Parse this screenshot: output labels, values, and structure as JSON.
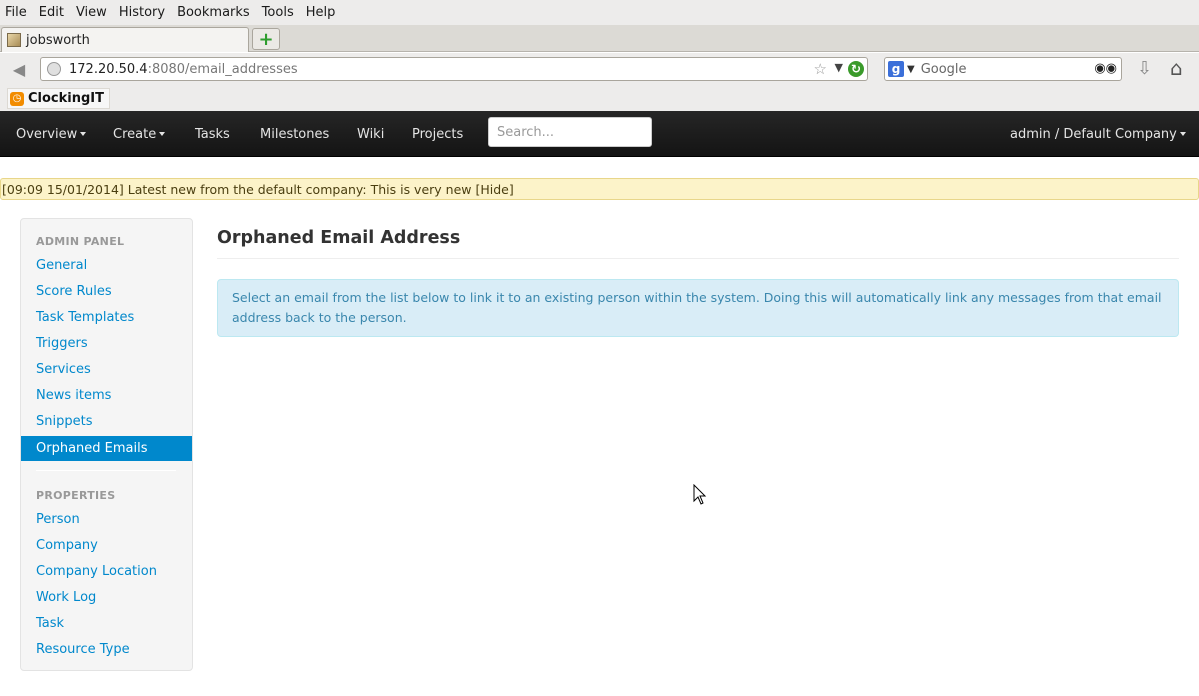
{
  "browser": {
    "menu": [
      "File",
      "Edit",
      "View",
      "History",
      "Bookmarks",
      "Tools",
      "Help"
    ],
    "tab_title": "jobsworth",
    "new_tab_icon": "plus-icon",
    "url_host": "172.20.50.4",
    "url_path": ":8080/email_addresses",
    "search_placeholder": "Google",
    "bookmark_label": "ClockingIT"
  },
  "appnav": {
    "overview": "Overview",
    "create": "Create",
    "tasks": "Tasks",
    "milestones": "Milestones",
    "wiki": "Wiki",
    "projects": "Projects",
    "search_placeholder": "Search...",
    "user_menu": "admin / Default Company"
  },
  "news": {
    "text": "[09:09 15/01/2014] Latest new from the default company: This is very new",
    "hide_label": "[Hide]"
  },
  "sidebar": {
    "admin_header": "ADMIN PANEL",
    "admin_items": [
      "General",
      "Score Rules",
      "Task Templates",
      "Triggers",
      "Services",
      "News items",
      "Snippets"
    ],
    "active_item": "Orphaned Emails",
    "properties_header": "PROPERTIES",
    "property_items": [
      "Person",
      "Company",
      "Company Location",
      "Work Log",
      "Task",
      "Resource Type"
    ]
  },
  "main": {
    "title": "Orphaned Email Address",
    "info_text": "Select an email from the list below to link it to an existing person within the system. Doing this will automatically link any messages from that email address back to the person."
  },
  "colors": {
    "link": "#0088cc",
    "nav_bg": "#1b1b1b",
    "alert_bg": "#d9edf7",
    "news_bg": "#fcf3c9"
  }
}
